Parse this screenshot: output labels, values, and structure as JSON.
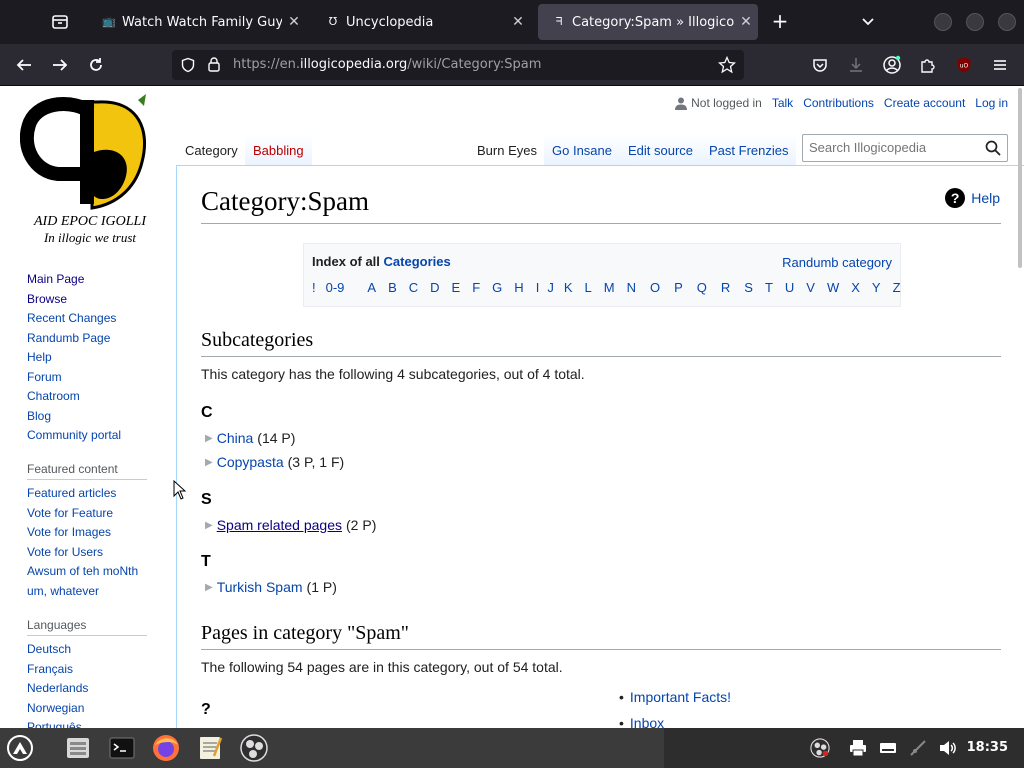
{
  "browser": {
    "tabs": [
      {
        "title": "Watch Watch Family Guy Onl",
        "favicon": "tv-icon",
        "active": false
      },
      {
        "title": "Uncyclopedia",
        "favicon": "uncyclopedia-potato-icon",
        "active": false
      },
      {
        "title": "Category:Spam » Illogicoped",
        "favicon": "illogicopedia-icon",
        "active": true
      }
    ],
    "url_prefix": "https://en.",
    "url_host": "illogicopedia.org",
    "url_path": "/wiki/Category:Spam",
    "close_glyph": "✕",
    "new_tab_glyph": "+"
  },
  "logo": {
    "motto_top": "AID EPOC IGOLLI",
    "motto_bottom": "In illogic we trust"
  },
  "sidebar": {
    "nav": [
      "Main Page",
      "Browse",
      "Recent Changes",
      "Randumb Page",
      "Help",
      "Forum",
      "Chatroom",
      "Blog",
      "Community portal"
    ],
    "featured_heading": "Featured content",
    "featured": [
      "Featured articles",
      "Vote for Feature",
      "Vote for Images",
      "Vote for Users",
      "Awsum of teh moNth",
      "um, whatever"
    ],
    "languages_heading": "Languages",
    "languages": [
      "Deutsch",
      "Français",
      "Nederlands",
      "Norwegian",
      "Português"
    ]
  },
  "personal": {
    "not_logged_in": "Not logged in",
    "talk": "Talk",
    "contributions": "Contributions",
    "create_account": "Create account",
    "login": "Log in"
  },
  "page_tabs": {
    "category": "Category",
    "babbling": "Babbling",
    "burn_eyes": "Burn Eyes",
    "go_insane": "Go Insane",
    "edit_source": "Edit source",
    "past_frenzies": "Past Frenzies"
  },
  "search": {
    "placeholder": "Search Illogicopedia"
  },
  "content": {
    "title": "Category:Spam",
    "help": "Help",
    "index_prefix": "Index of all ",
    "index_link": "Categories",
    "randumb_category": "Randumb category",
    "letters": [
      "!",
      "0-9",
      "A",
      "B",
      "C",
      "D",
      "E",
      "F",
      "G",
      "H",
      "I",
      "J",
      "K",
      "L",
      "M",
      "N",
      "O",
      "P",
      "Q",
      "R",
      "S",
      "T",
      "U",
      "V",
      "W",
      "X",
      "Y",
      "Z"
    ],
    "subcategories_heading": "Subcategories",
    "subcategories_text": "This category has the following 4 subcategories, out of 4 total.",
    "groups": [
      {
        "letter": "C",
        "items": [
          {
            "name": "China",
            "count": "(14 P)"
          },
          {
            "name": "Copypasta",
            "count": "(3 P, 1 F)"
          }
        ]
      },
      {
        "letter": "S",
        "items": [
          {
            "name": "Spam related pages",
            "count": "(2 P)"
          }
        ]
      },
      {
        "letter": "T",
        "items": [
          {
            "name": "Turkish Spam",
            "count": "(1 P)"
          }
        ]
      }
    ],
    "pages_heading": "Pages in category \"Spam\"",
    "pages_text": "The following 54 pages are in this category, out of 54 total.",
    "pages_letter": "?",
    "pages_list": [
      "Important Facts!",
      "Inbox"
    ]
  },
  "taskbar": {
    "clock": "18:35"
  }
}
